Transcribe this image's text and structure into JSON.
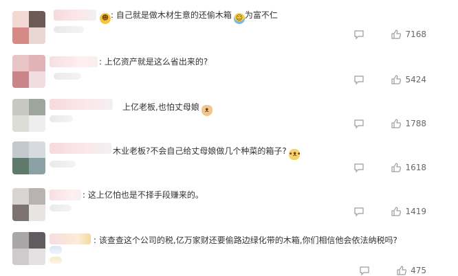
{
  "comments": [
    {
      "prefix": ":",
      "text": "自己就是做木材生意的还偷木箱",
      "after_emoji": "为富不仁",
      "like_count": "7168"
    },
    {
      "prefix": ":",
      "text": "上亿资产就是这么省出来的?",
      "like_count": "5424"
    },
    {
      "text": "上亿老板,也怕丈母娘",
      "like_count": "1788"
    },
    {
      "text": "木业老板?不会自己给丈母娘做几个种菜的箱子?",
      "like_count": "1618"
    },
    {
      "prefix": ":",
      "text": "这上亿怕也是不择手段赚来的。",
      "like_count": "1419"
    },
    {
      "prefix": ":",
      "text": "该查查这个公司的税,亿万家财还要偷路边绿化带的木箱,你们相信他会依法纳税吗?",
      "like_count": "475"
    }
  ],
  "icons": [
    "comment-icon",
    "thumbs-up-icon",
    "smile-emoji-icon",
    "laughing-emoji-icon",
    "cat-emoji-icon",
    "dog-emoji-icon"
  ],
  "colors": {
    "text": "#333333",
    "count": "#666666",
    "icon": "#9a9a9a"
  }
}
